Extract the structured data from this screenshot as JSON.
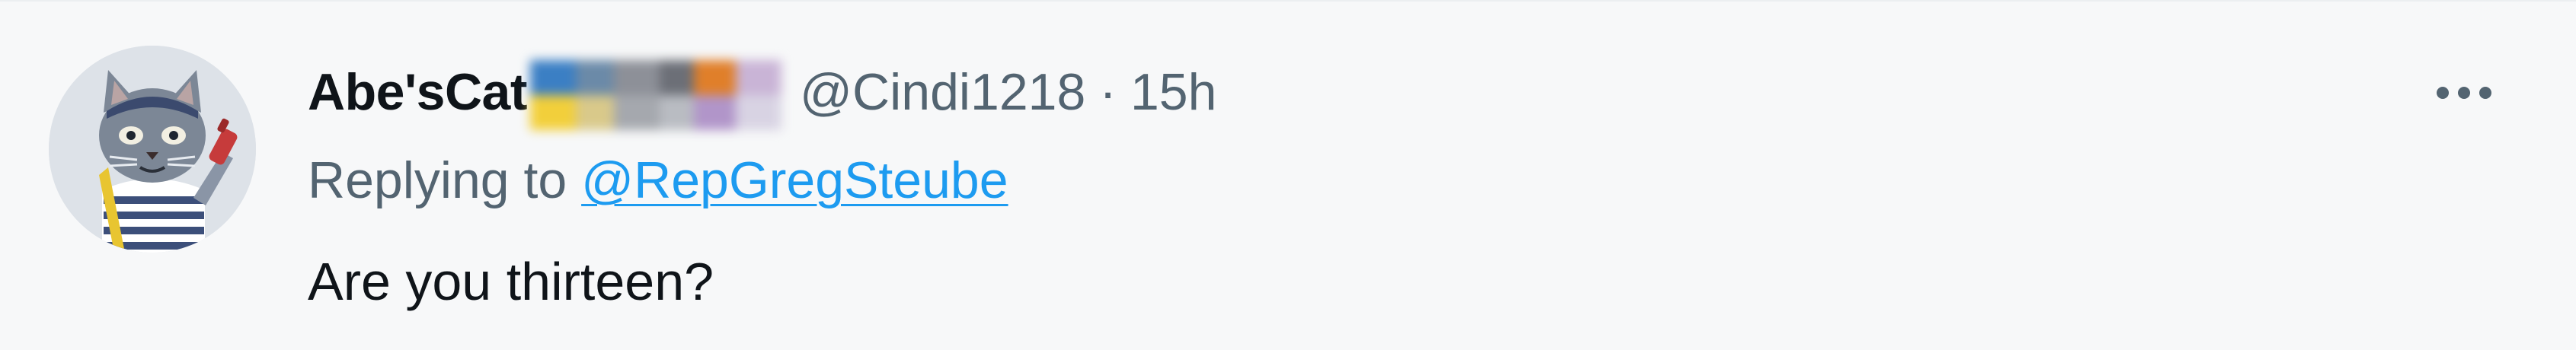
{
  "tweet": {
    "display_name": "Abe'sCat",
    "handle": "@Cindi1218",
    "separator": "·",
    "time": "15h",
    "replying_prefix": "Replying to",
    "replying_to": "@RepGregSteube",
    "text": "Are you thirteen?"
  },
  "icons": {
    "avatar": "cat-avatar-icon",
    "more": "more-icon"
  },
  "colors": {
    "background": "#f7f8f9",
    "primary_text": "#0f1419",
    "secondary_text": "#536471",
    "link": "#1d9bf0"
  }
}
